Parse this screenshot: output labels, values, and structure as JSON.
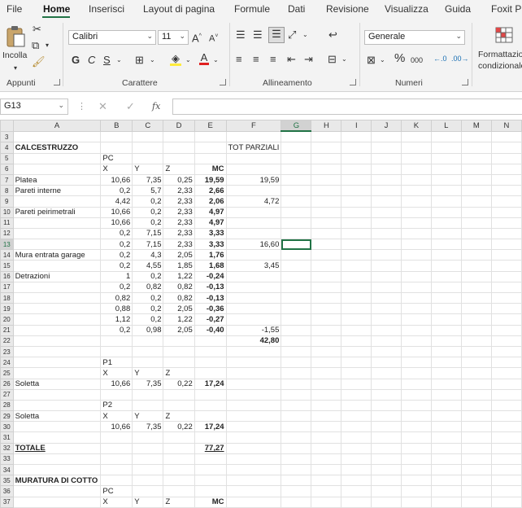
{
  "menu_tabs": [
    "File",
    "Home",
    "Inserisci",
    "Layout di pagina",
    "Formule",
    "Dati",
    "Revisione",
    "Visualizza",
    "Guida",
    "Foxit PD"
  ],
  "ribbon": {
    "clipboard": {
      "paste_label": "Incolla",
      "group_label": "Appunti"
    },
    "font": {
      "font_name": "Calibri",
      "font_size": "11",
      "bold": "G",
      "italic": "C",
      "underline": "S",
      "increase": "A^",
      "decrease": "A˅",
      "group_label": "Carattere"
    },
    "alignment": {
      "group_label": "Allineamento"
    },
    "number": {
      "format": "Generale",
      "percent": "%",
      "thousands": "000",
      "group_label": "Numeri"
    },
    "styles": {
      "cond_format_line1": "Formattazio",
      "cond_format_line2": "condizionale"
    }
  },
  "formula_bar": {
    "name_box": "G13",
    "fx": "fx",
    "content": ""
  },
  "accent_color": "#217346",
  "columns": [
    "A",
    "B",
    "C",
    "D",
    "E",
    "F",
    "G",
    "H",
    "I",
    "J",
    "K",
    "L",
    "M",
    "N"
  ],
  "rows": [
    {
      "n": "3",
      "c": [
        "",
        "",
        "",
        "",
        "",
        "",
        "",
        "",
        "",
        "",
        "",
        "",
        "",
        ""
      ]
    },
    {
      "n": "4",
      "c": [
        "CALCESTRUZZO",
        "",
        "",
        "",
        "",
        "TOT PARZIALI",
        "",
        "",
        "",
        "",
        "",
        "",
        "",
        ""
      ]
    },
    {
      "n": "5",
      "c": [
        "",
        "PC",
        "",
        "",
        "",
        "",
        "",
        "",
        "",
        "",
        "",
        "",
        "",
        ""
      ]
    },
    {
      "n": "6",
      "c": [
        "",
        "X",
        "Y",
        "Z",
        "MC",
        "",
        "",
        "",
        "",
        "",
        "",
        "",
        "",
        ""
      ]
    },
    {
      "n": "7",
      "c": [
        "Platea",
        "10,66",
        "7,35",
        "0,25",
        "19,59",
        "19,59",
        "",
        "",
        "",
        "",
        "",
        "",
        "",
        ""
      ]
    },
    {
      "n": "8",
      "c": [
        "Pareti interne",
        "0,2",
        "5,7",
        "2,33",
        "2,66",
        "",
        "",
        "",
        "",
        "",
        "",
        "",
        "",
        ""
      ]
    },
    {
      "n": "9",
      "c": [
        "",
        "4,42",
        "0,2",
        "2,33",
        "2,06",
        "4,72",
        "",
        "",
        "",
        "",
        "",
        "",
        "",
        ""
      ]
    },
    {
      "n": "10",
      "c": [
        "Pareti peirimetrali",
        "10,66",
        "0,2",
        "2,33",
        "4,97",
        "",
        "",
        "",
        "",
        "",
        "",
        "",
        "",
        ""
      ]
    },
    {
      "n": "11",
      "c": [
        "",
        "10,66",
        "0,2",
        "2,33",
        "4,97",
        "",
        "",
        "",
        "",
        "",
        "",
        "",
        "",
        ""
      ]
    },
    {
      "n": "12",
      "c": [
        "",
        "0,2",
        "7,15",
        "2,33",
        "3,33",
        "",
        "",
        "",
        "",
        "",
        "",
        "",
        "",
        ""
      ]
    },
    {
      "n": "13",
      "c": [
        "",
        "0,2",
        "7,15",
        "2,33",
        "3,33",
        "16,60",
        "",
        "",
        "",
        "",
        "",
        "",
        "",
        ""
      ]
    },
    {
      "n": "14",
      "c": [
        "Mura entrata garage",
        "0,2",
        "4,3",
        "2,05",
        "1,76",
        "",
        "",
        "",
        "",
        "",
        "",
        "",
        "",
        ""
      ]
    },
    {
      "n": "15",
      "c": [
        "",
        "0,2",
        "4,55",
        "1,85",
        "1,68",
        "3,45",
        "",
        "",
        "",
        "",
        "",
        "",
        "",
        ""
      ]
    },
    {
      "n": "16",
      "c": [
        "Detrazioni",
        "1",
        "0,2",
        "1,22",
        "-0,24",
        "",
        "",
        "",
        "",
        "",
        "",
        "",
        "",
        ""
      ]
    },
    {
      "n": "17",
      "c": [
        "",
        "0,2",
        "0,82",
        "0,82",
        "-0,13",
        "",
        "",
        "",
        "",
        "",
        "",
        "",
        "",
        ""
      ]
    },
    {
      "n": "18",
      "c": [
        "",
        "0,82",
        "0,2",
        "0,82",
        "-0,13",
        "",
        "",
        "",
        "",
        "",
        "",
        "",
        "",
        ""
      ]
    },
    {
      "n": "19",
      "c": [
        "",
        "0,88",
        "0,2",
        "2,05",
        "-0,36",
        "",
        "",
        "",
        "",
        "",
        "",
        "",
        "",
        ""
      ]
    },
    {
      "n": "20",
      "c": [
        "",
        "1,12",
        "0,2",
        "1,22",
        "-0,27",
        "",
        "",
        "",
        "",
        "",
        "",
        "",
        "",
        ""
      ]
    },
    {
      "n": "21",
      "c": [
        "",
        "0,2",
        "0,98",
        "2,05",
        "-0,40",
        "-1,55",
        "",
        "",
        "",
        "",
        "",
        "",
        "",
        ""
      ]
    },
    {
      "n": "22",
      "c": [
        "",
        "",
        "",
        "",
        "",
        "42,80",
        "",
        "",
        "",
        "",
        "",
        "",
        "",
        ""
      ]
    },
    {
      "n": "23",
      "c": [
        "",
        "",
        "",
        "",
        "",
        "",
        "",
        "",
        "",
        "",
        "",
        "",
        "",
        ""
      ]
    },
    {
      "n": "24",
      "c": [
        "",
        "P1",
        "",
        "",
        "",
        "",
        "",
        "",
        "",
        "",
        "",
        "",
        "",
        ""
      ]
    },
    {
      "n": "25",
      "c": [
        "",
        "X",
        "Y",
        "Z",
        "",
        "",
        "",
        "",
        "",
        "",
        "",
        "",
        "",
        ""
      ]
    },
    {
      "n": "26",
      "c": [
        "Soletta",
        "10,66",
        "7,35",
        "0,22",
        "17,24",
        "",
        "",
        "",
        "",
        "",
        "",
        "",
        "",
        ""
      ]
    },
    {
      "n": "27",
      "c": [
        "",
        "",
        "",
        "",
        "",
        "",
        "",
        "",
        "",
        "",
        "",
        "",
        "",
        ""
      ]
    },
    {
      "n": "28",
      "c": [
        "",
        "P2",
        "",
        "",
        "",
        "",
        "",
        "",
        "",
        "",
        "",
        "",
        "",
        ""
      ]
    },
    {
      "n": "29",
      "c": [
        "Soletta",
        "X",
        "Y",
        "Z",
        "",
        "",
        "",
        "",
        "",
        "",
        "",
        "",
        "",
        ""
      ]
    },
    {
      "n": "30",
      "c": [
        "",
        "10,66",
        "7,35",
        "0,22",
        "17,24",
        "",
        "",
        "",
        "",
        "",
        "",
        "",
        "",
        ""
      ]
    },
    {
      "n": "31",
      "c": [
        "",
        "",
        "",
        "",
        "",
        "",
        "",
        "",
        "",
        "",
        "",
        "",
        "",
        ""
      ]
    },
    {
      "n": "32",
      "c": [
        "TOTALE",
        "",
        "",
        "",
        "77,27",
        "",
        "",
        "",
        "",
        "",
        "",
        "",
        "",
        ""
      ]
    },
    {
      "n": "33",
      "c": [
        "",
        "",
        "",
        "",
        "",
        "",
        "",
        "",
        "",
        "",
        "",
        "",
        "",
        ""
      ]
    },
    {
      "n": "34",
      "c": [
        "",
        "",
        "",
        "",
        "",
        "",
        "",
        "",
        "",
        "",
        "",
        "",
        "",
        ""
      ]
    },
    {
      "n": "35",
      "c": [
        "MURATURA DI COTTO",
        "",
        "",
        "",
        "",
        "",
        "",
        "",
        "",
        "",
        "",
        "",
        "",
        ""
      ]
    },
    {
      "n": "36",
      "c": [
        "",
        "PC",
        "",
        "",
        "",
        "",
        "",
        "",
        "",
        "",
        "",
        "",
        "",
        ""
      ]
    },
    {
      "n": "37",
      "c": [
        "",
        "X",
        "Y",
        "Z",
        "MC",
        "",
        "",
        "",
        "",
        "",
        "",
        "",
        "",
        ""
      ]
    }
  ],
  "active_cell": "G13"
}
